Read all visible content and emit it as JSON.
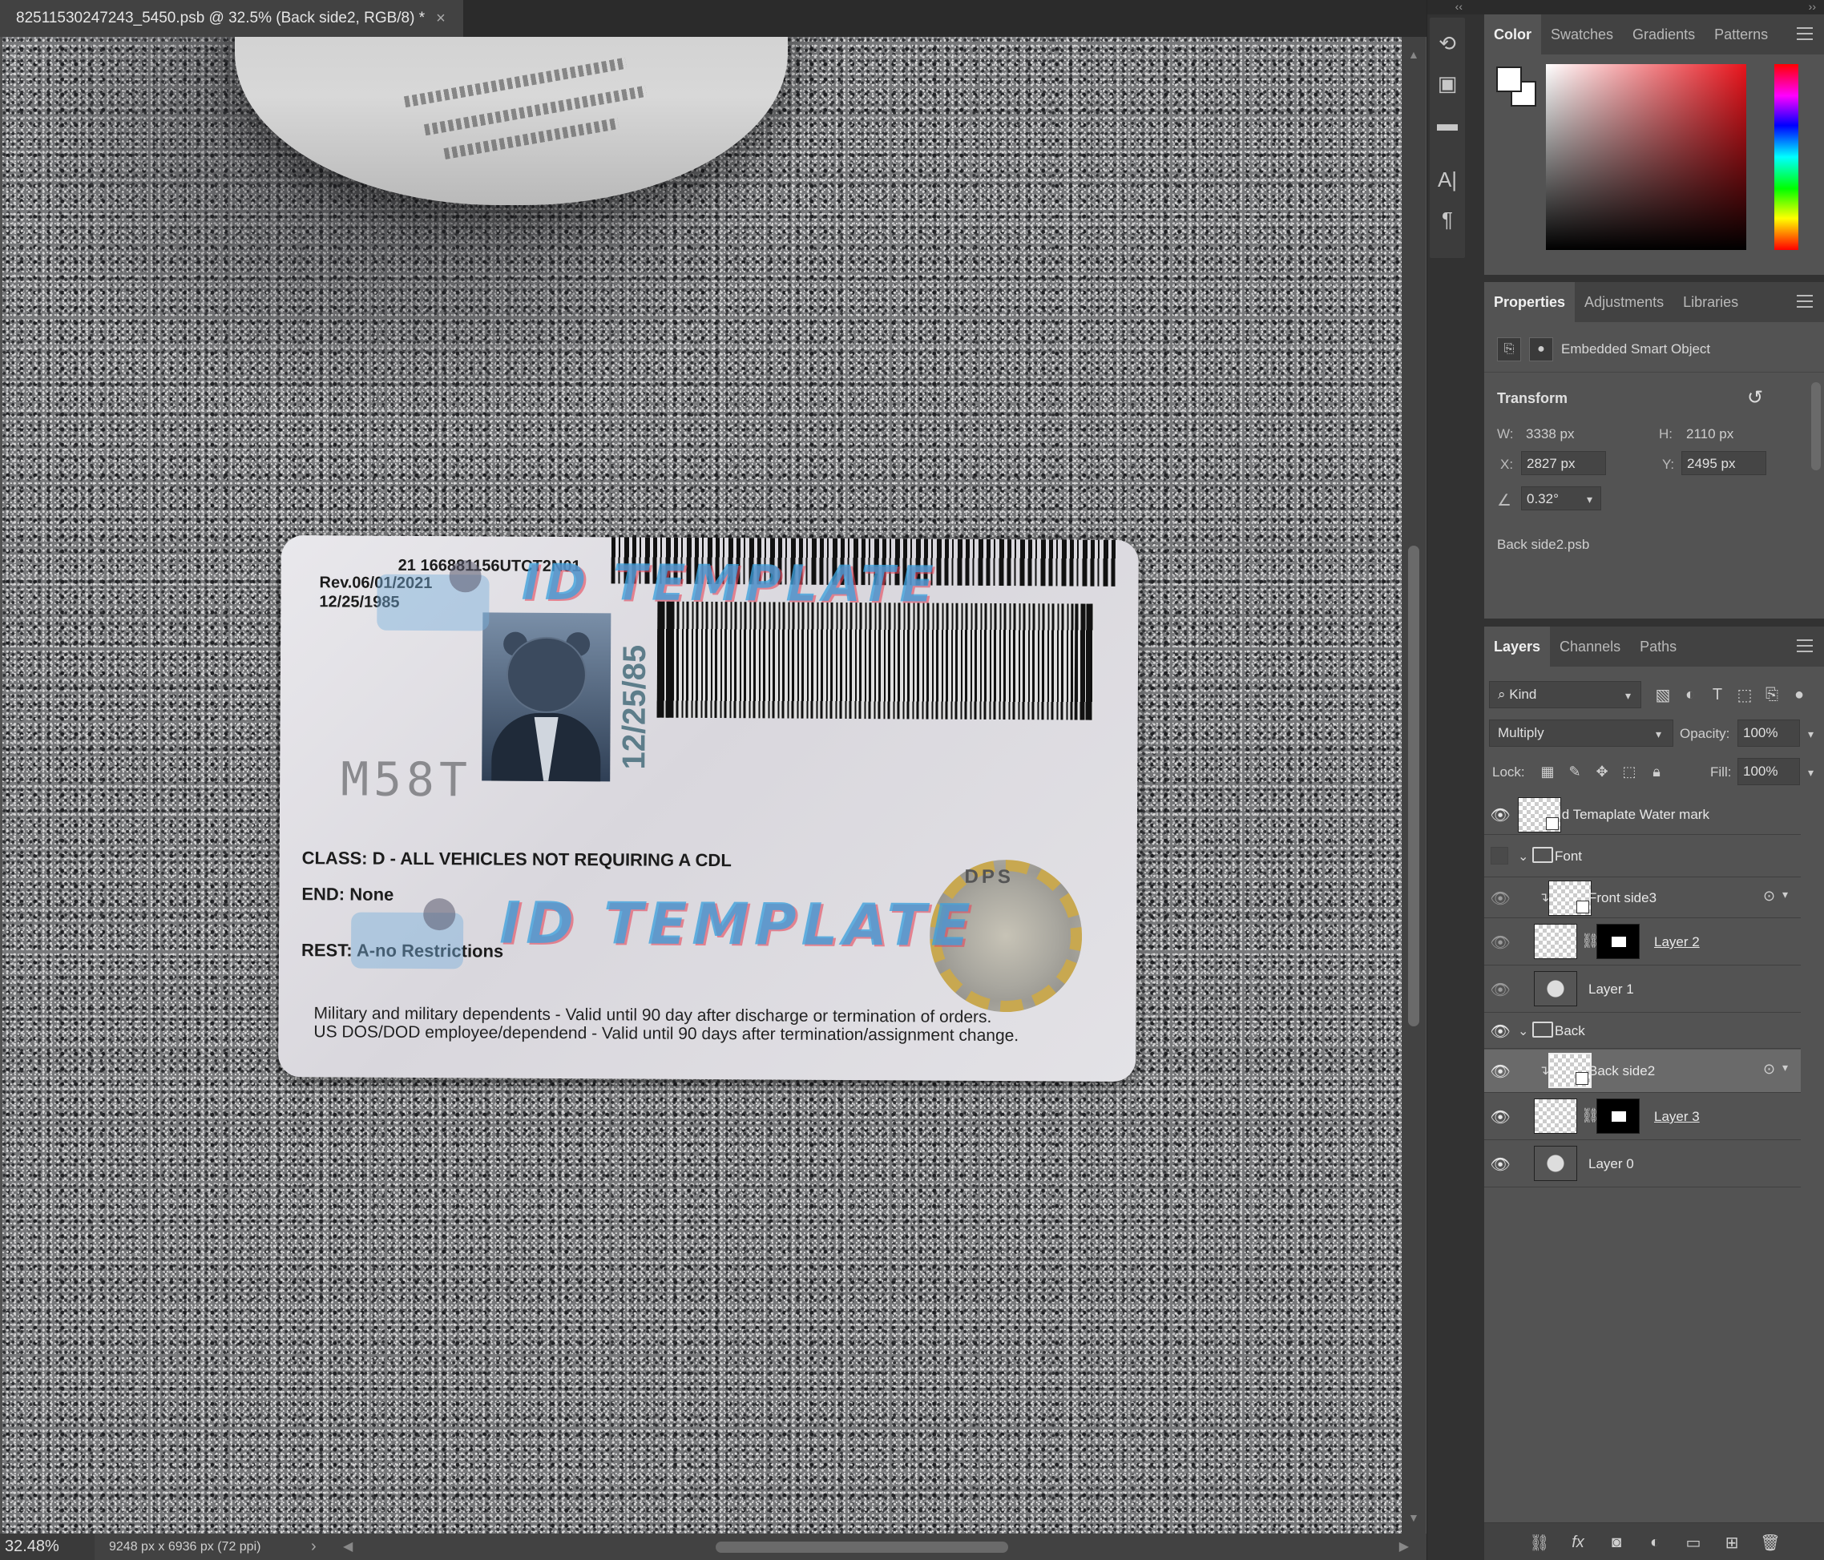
{
  "document": {
    "tab_title": "82511530247243_5450.psb @ 32.5% (Back side2, RGB/8) *",
    "close_glyph": "×"
  },
  "card": {
    "code": "21 166881156UTCT2N01",
    "rev": "Rev.06/01/2021",
    "dob": "12/25/1985",
    "vertical_dob": "12/25/85",
    "serial": "M58T",
    "class_line": "CLASS: D - ALL VEHICLES NOT REQUIRING A CDL",
    "end_line": "END: None",
    "rest_line": "REST: A-no Restrictions",
    "military_line1": "Military and military dependents - Valid until 90 day after discharge or termination of orders.",
    "military_line2": "US DOS/DOD employee/dependend - Valid until 90 days after termination/assignment change.",
    "seal_label": "DPS",
    "watermark": "ID TEMPLATE"
  },
  "status": {
    "zoom": "32.48%",
    "doc_size": "9248 px x 6936 px (72 ppi)",
    "arrow": "›"
  },
  "color_panel": {
    "tabs": [
      "Color",
      "Swatches",
      "Gradients",
      "Patterns"
    ],
    "foreground": "#ffffff",
    "background": "#ffffff"
  },
  "properties_panel": {
    "tabs": [
      "Properties",
      "Adjustments",
      "Libraries"
    ],
    "kind": "Embedded Smart Object",
    "transform_title": "Transform",
    "w_label": "W:",
    "w_value": "3338 px",
    "h_label": "H:",
    "h_value": "2110 px",
    "x_label": "X:",
    "x_value": "2827 px",
    "y_label": "Y:",
    "y_value": "2495 px",
    "angle_value": "0.32°",
    "file_name": "Back side2.psb"
  },
  "layers_panel": {
    "tabs": [
      "Layers",
      "Channels",
      "Paths"
    ],
    "kind_filter": "Kind",
    "blend_mode": "Multiply",
    "opacity_label": "Opacity:",
    "opacity_value": "100%",
    "lock_label": "Lock:",
    "fill_label": "Fill:",
    "fill_value": "100%",
    "layers": [
      {
        "name": "Id Temaplate Water mark"
      },
      {
        "name": "Font"
      },
      {
        "name": "Front side3"
      },
      {
        "name": "Layer 2"
      },
      {
        "name": "Layer 1"
      },
      {
        "name": "Back"
      },
      {
        "name": "Back side2"
      },
      {
        "name": "Layer 3"
      },
      {
        "name": "Layer 0"
      }
    ]
  },
  "icons": {
    "eye": "eye-icon",
    "folder": "folder-icon",
    "chain": "chain-link-icon"
  }
}
